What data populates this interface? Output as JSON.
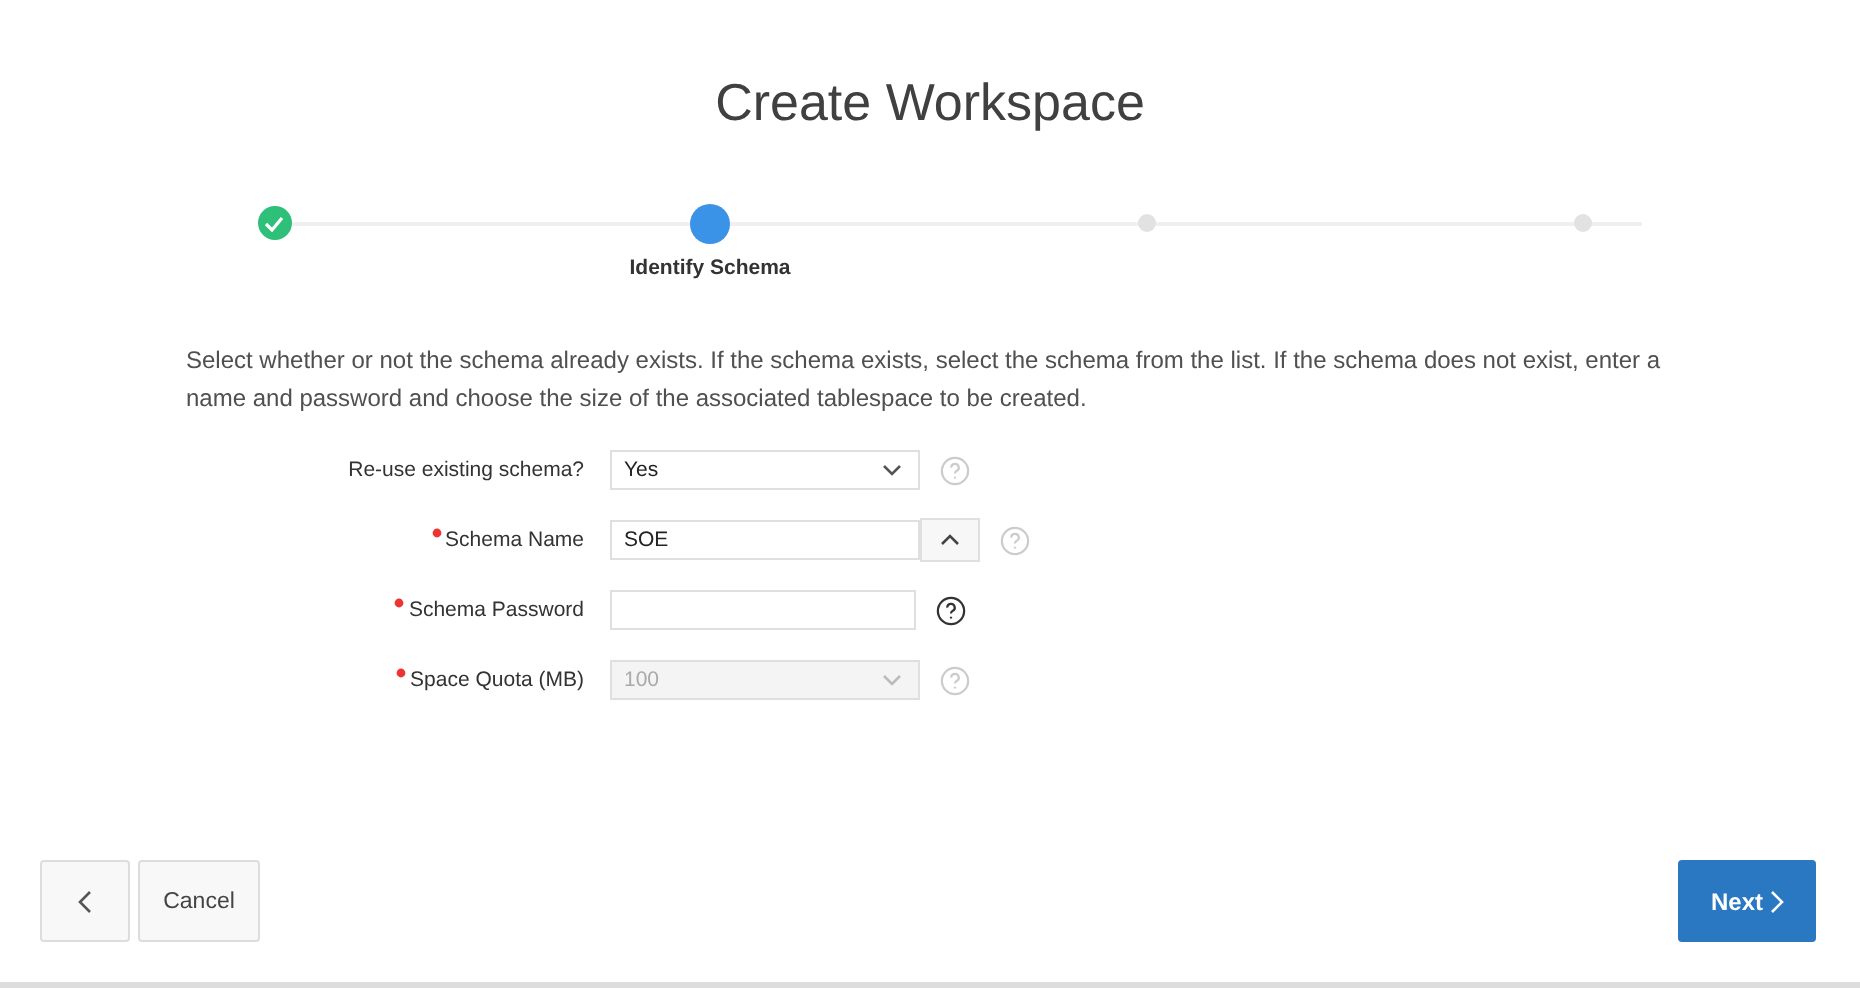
{
  "title": "Create Workspace",
  "steps": [
    {
      "completed": true,
      "selected": false
    },
    {
      "completed": false,
      "selected": true,
      "label": "Identify Schema"
    },
    {
      "completed": false,
      "selected": false
    },
    {
      "completed": false,
      "selected": false
    }
  ],
  "description": "Select whether or not the schema already exists. If the schema exists, select the schema from the list. If the schema does not exist, enter a name and password and choose the size of the associated tablespace to be created.",
  "fields": [
    {
      "kind": "select",
      "label": "Re-use existing schema?",
      "required": false,
      "value": "Yes",
      "disabled": false,
      "help_highlighted": false
    },
    {
      "kind": "popup",
      "label": "Schema Name",
      "required": true,
      "value": "SOE",
      "disabled": false,
      "help_highlighted": false
    },
    {
      "kind": "password",
      "label": "Schema Password",
      "required": true,
      "disabled": false,
      "help_highlighted": true
    },
    {
      "kind": "select",
      "label": "Space Quota (MB)",
      "required": true,
      "value": "100",
      "disabled": true,
      "help_highlighted": false
    }
  ],
  "buttons": {
    "cancel": "Cancel",
    "next": "Next"
  }
}
